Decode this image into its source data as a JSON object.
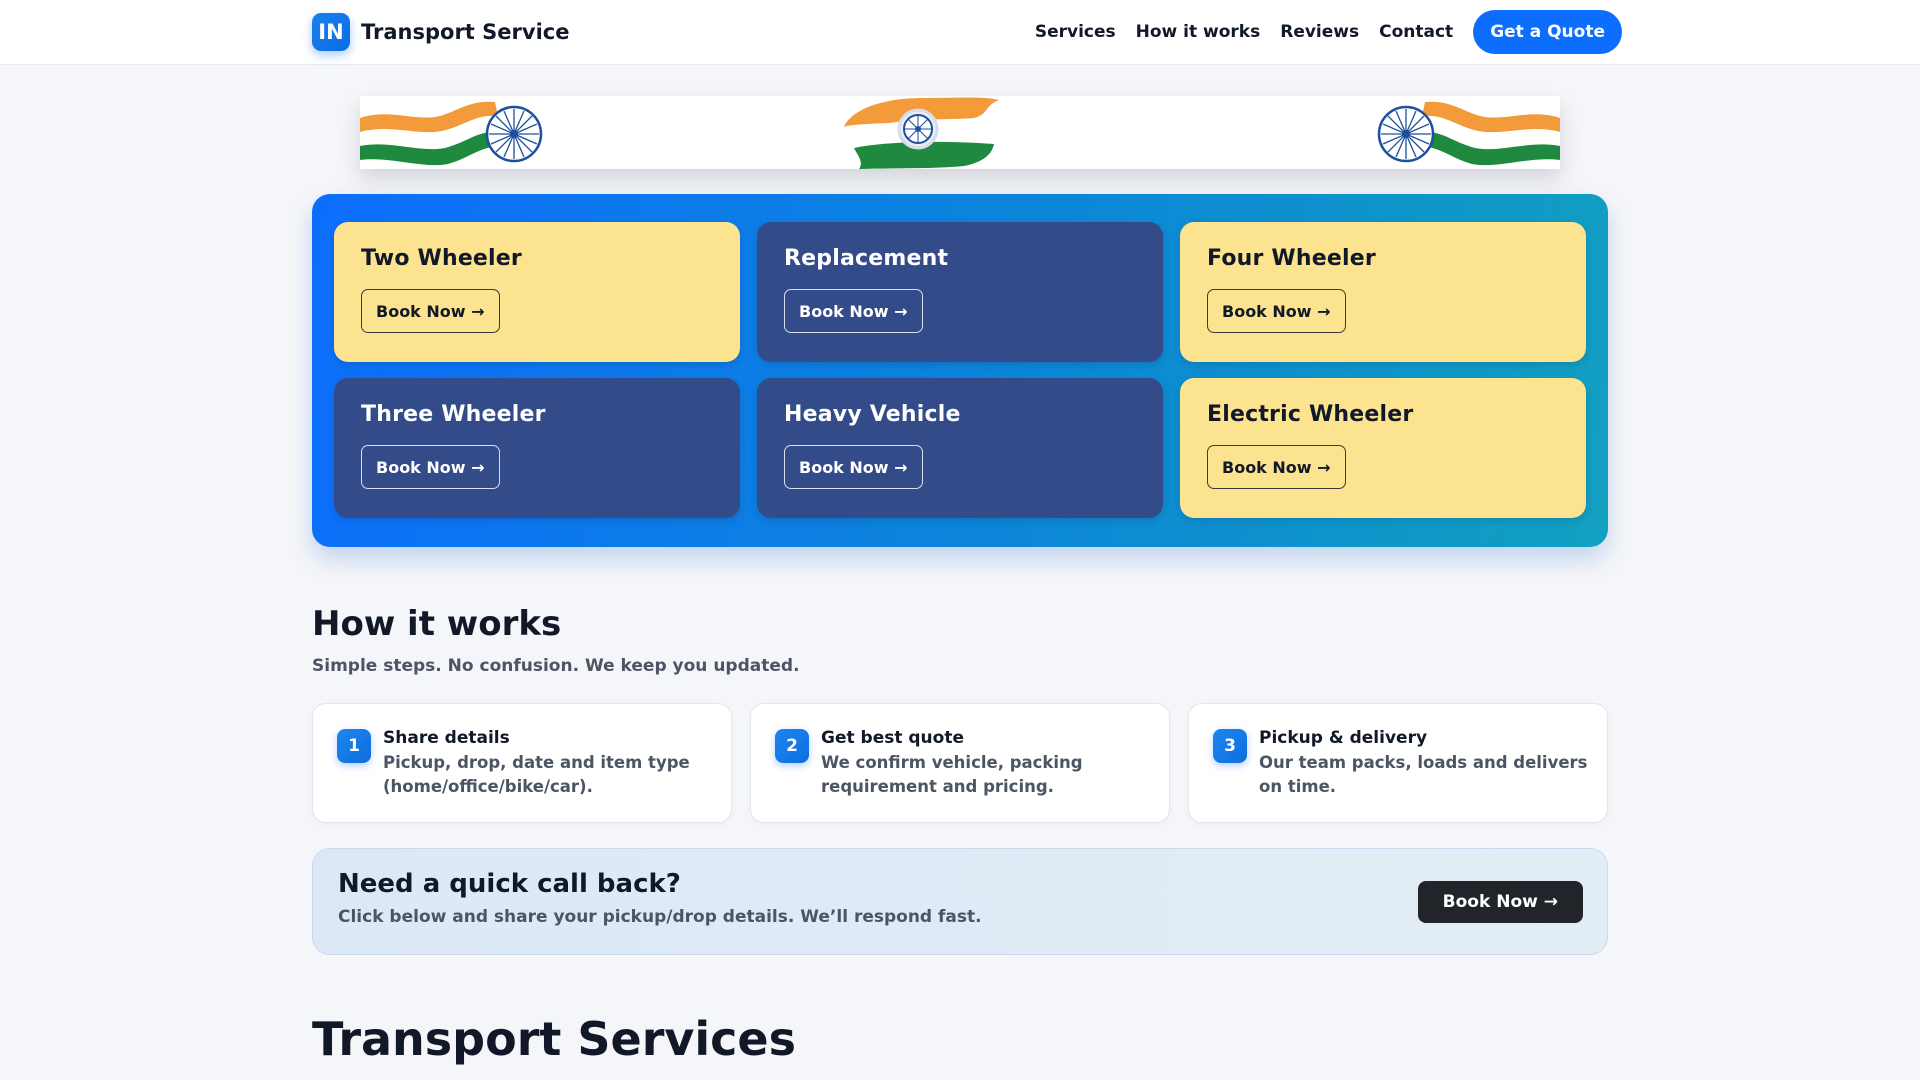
{
  "header": {
    "logo_text": "IN",
    "brand": "Transport Service",
    "nav": [
      "Services",
      "How it works",
      "Reviews",
      "Contact"
    ],
    "cta": "Get a Quote"
  },
  "services": [
    {
      "title": "Two Wheeler",
      "button": "Book Now →"
    },
    {
      "title": "Replacement",
      "button": "Book Now →"
    },
    {
      "title": "Four Wheeler",
      "button": "Book Now →"
    },
    {
      "title": "Three Wheeler",
      "button": "Book Now →"
    },
    {
      "title": "Heavy Vehicle",
      "button": "Book Now →"
    },
    {
      "title": "Electric Wheeler",
      "button": "Book Now →"
    }
  ],
  "how_it_works": {
    "title": "How it works",
    "subtitle": "Simple steps. No confusion. We keep you updated.",
    "steps": [
      {
        "num": "1",
        "title": "Share details",
        "desc": "Pickup, drop, date and item type (home/office/bike/car)."
      },
      {
        "num": "2",
        "title": "Get best quote",
        "desc": "We confirm vehicle, packing requirement and pricing."
      },
      {
        "num": "3",
        "title": "Pickup & delivery",
        "desc": "Our team packs, loads and delivers on time."
      }
    ]
  },
  "callback": {
    "title": "Need a quick call back?",
    "subtitle": "Click below and share your pickup/drop details. We’ll respond fast.",
    "button": "Book Now →"
  },
  "section_title": "Transport Services",
  "colors": {
    "primary": "#0d6efd",
    "card_light": "#fbe38f",
    "card_dark": "#344b8a",
    "saffron": "#f39a3a",
    "green": "#1f8a3f",
    "chakra": "#1d4f9c"
  }
}
